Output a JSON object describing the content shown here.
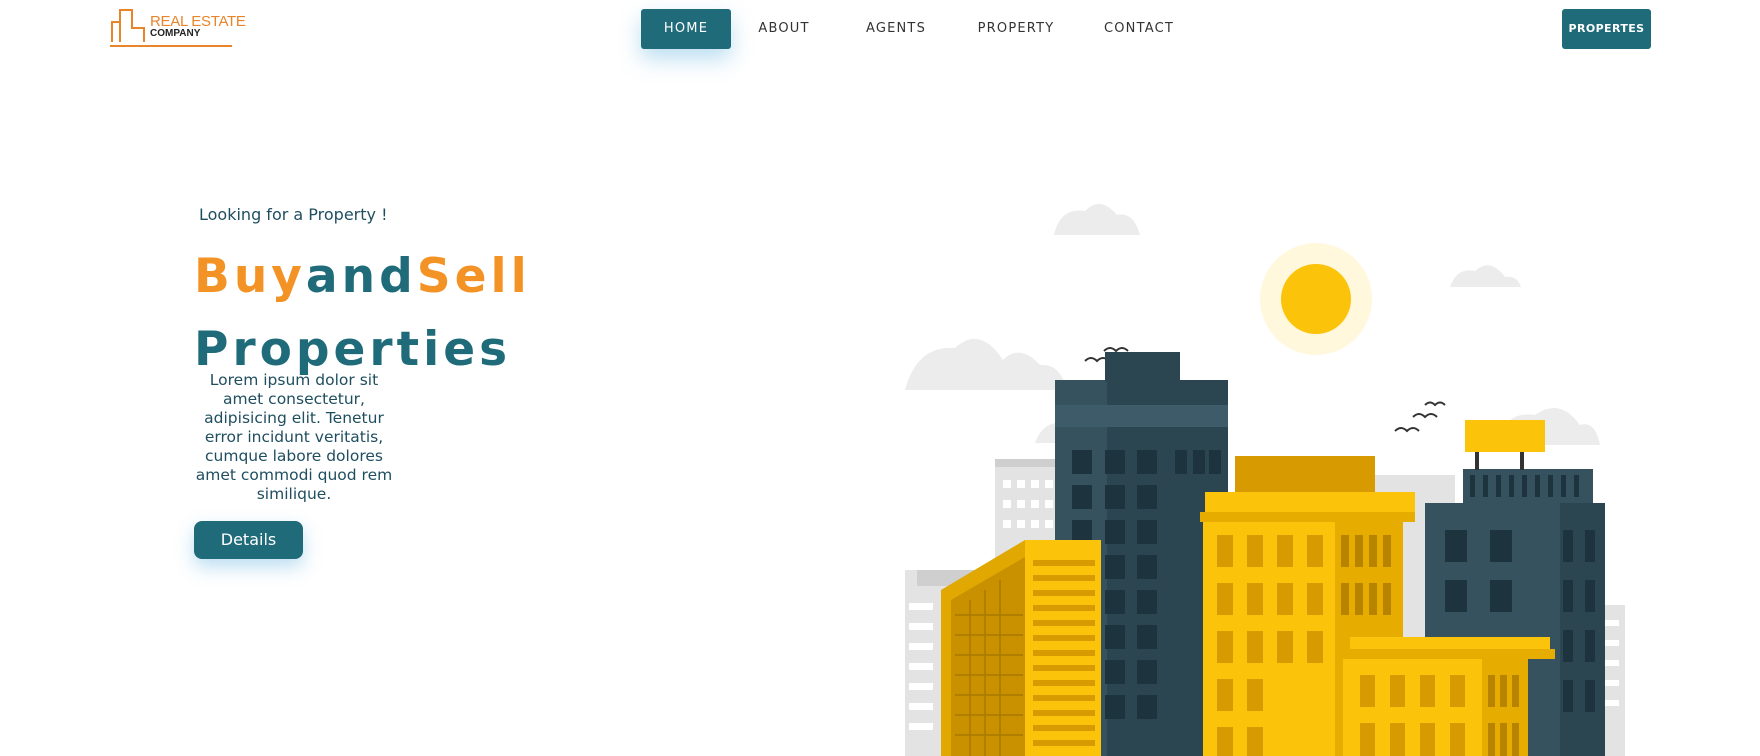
{
  "logo": {
    "line1": "REAL ESTATE",
    "line2": "COMPANY"
  },
  "nav": [
    {
      "label": "HOME",
      "active": true
    },
    {
      "label": "ABOUT",
      "active": false
    },
    {
      "label": "AGENTS",
      "active": false
    },
    {
      "label": "PROPERTY",
      "active": false
    },
    {
      "label": "CONTACT",
      "active": false
    }
  ],
  "top_button": "PROPERTES",
  "hero": {
    "tagline": "Looking for a Property !",
    "headline": {
      "word1": "Buy",
      "word2": "and",
      "word3": "Sell",
      "line2": "Properties"
    },
    "description": "Lorem ipsum dolor sit amet consectetur, adipisicing elit. Tenetur error incidunt veritatis, cumque labore dolores amet commodi quod rem similique.",
    "button": "Details"
  },
  "colors": {
    "primary": "#1f6b7a",
    "accent": "#f39325",
    "building_yellow": "#fcc30b",
    "building_dark": "#36525f"
  },
  "icons": [
    "logo-building-icon",
    "city-illustration"
  ]
}
